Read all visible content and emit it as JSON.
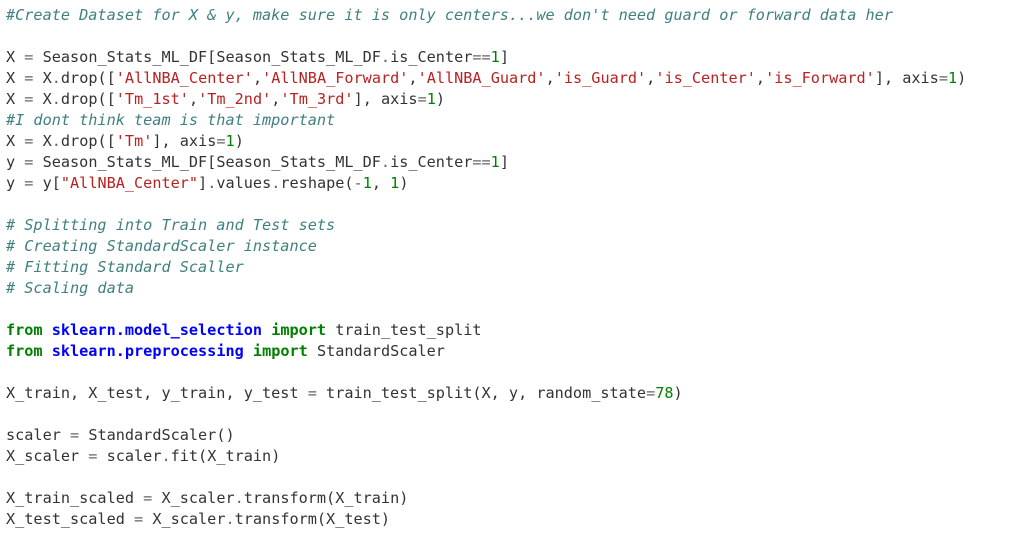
{
  "code_cell": {
    "lines": [
      [
        [
          "comment",
          "#Create Dataset for X & y, make sure it is only centers...we don't need guard or forward data her"
        ]
      ],
      [],
      [
        [
          "text",
          "X "
        ],
        [
          "op",
          "="
        ],
        [
          "text",
          " Season_Stats_ML_DF[Season_Stats_ML_DF"
        ],
        [
          "op",
          "."
        ],
        [
          "text",
          "is_Center"
        ],
        [
          "op",
          "=="
        ],
        [
          "number",
          "1"
        ],
        [
          "text",
          "]"
        ]
      ],
      [
        [
          "text",
          "X "
        ],
        [
          "op",
          "="
        ],
        [
          "text",
          " X"
        ],
        [
          "op",
          "."
        ],
        [
          "text",
          "drop(["
        ],
        [
          "string",
          "'AllNBA_Center'"
        ],
        [
          "text",
          ","
        ],
        [
          "string",
          "'AllNBA_Forward'"
        ],
        [
          "text",
          ","
        ],
        [
          "string",
          "'AllNBA_Guard'"
        ],
        [
          "text",
          ","
        ],
        [
          "string",
          "'is_Guard'"
        ],
        [
          "text",
          ","
        ],
        [
          "string",
          "'is_Center'"
        ],
        [
          "text",
          ","
        ],
        [
          "string",
          "'is_Forward'"
        ],
        [
          "text",
          "], axis"
        ],
        [
          "op",
          "="
        ],
        [
          "number",
          "1"
        ],
        [
          "text",
          ")"
        ]
      ],
      [
        [
          "text",
          "X "
        ],
        [
          "op",
          "="
        ],
        [
          "text",
          " X"
        ],
        [
          "op",
          "."
        ],
        [
          "text",
          "drop(["
        ],
        [
          "string",
          "'Tm_1st'"
        ],
        [
          "text",
          ","
        ],
        [
          "string",
          "'Tm_2nd'"
        ],
        [
          "text",
          ","
        ],
        [
          "string",
          "'Tm_3rd'"
        ],
        [
          "text",
          "], axis"
        ],
        [
          "op",
          "="
        ],
        [
          "number",
          "1"
        ],
        [
          "text",
          ")"
        ]
      ],
      [
        [
          "comment",
          "#I dont think team is that important"
        ]
      ],
      [
        [
          "text",
          "X "
        ],
        [
          "op",
          "="
        ],
        [
          "text",
          " X"
        ],
        [
          "op",
          "."
        ],
        [
          "text",
          "drop(["
        ],
        [
          "string",
          "'Tm'"
        ],
        [
          "text",
          "], axis"
        ],
        [
          "op",
          "="
        ],
        [
          "number",
          "1"
        ],
        [
          "text",
          ")"
        ]
      ],
      [
        [
          "text",
          "y "
        ],
        [
          "op",
          "="
        ],
        [
          "text",
          " Season_Stats_ML_DF[Season_Stats_ML_DF"
        ],
        [
          "op",
          "."
        ],
        [
          "text",
          "is_Center"
        ],
        [
          "op",
          "=="
        ],
        [
          "number",
          "1"
        ],
        [
          "text",
          "]"
        ]
      ],
      [
        [
          "text",
          "y "
        ],
        [
          "op",
          "="
        ],
        [
          "text",
          " y["
        ],
        [
          "string",
          "\"AllNBA_Center\""
        ],
        [
          "text",
          "]"
        ],
        [
          "op",
          "."
        ],
        [
          "text",
          "values"
        ],
        [
          "op",
          "."
        ],
        [
          "text",
          "reshape("
        ],
        [
          "op",
          "-"
        ],
        [
          "number",
          "1"
        ],
        [
          "text",
          ", "
        ],
        [
          "number",
          "1"
        ],
        [
          "text",
          ")"
        ]
      ],
      [],
      [
        [
          "comment",
          "# Splitting into Train and Test sets"
        ]
      ],
      [
        [
          "comment",
          "# Creating StandardScaler instance"
        ]
      ],
      [
        [
          "comment",
          "# Fitting Standard Scaller"
        ]
      ],
      [
        [
          "comment",
          "# Scaling data"
        ]
      ],
      [],
      [
        [
          "keyword",
          "from"
        ],
        [
          "text",
          " "
        ],
        [
          "module",
          "sklearn.model_selection"
        ],
        [
          "text",
          " "
        ],
        [
          "keyword",
          "import"
        ],
        [
          "text",
          " train_test_split"
        ]
      ],
      [
        [
          "keyword",
          "from"
        ],
        [
          "text",
          " "
        ],
        [
          "module",
          "sklearn.preprocessing"
        ],
        [
          "text",
          " "
        ],
        [
          "keyword",
          "import"
        ],
        [
          "text",
          " StandardScaler"
        ]
      ],
      [],
      [
        [
          "text",
          "X_train, X_test, y_train, y_test "
        ],
        [
          "op",
          "="
        ],
        [
          "text",
          " train_test_split(X, y, random_state"
        ],
        [
          "op",
          "="
        ],
        [
          "number",
          "78"
        ],
        [
          "text",
          ")"
        ]
      ],
      [],
      [
        [
          "text",
          "scaler "
        ],
        [
          "op",
          "="
        ],
        [
          "text",
          " StandardScaler()"
        ]
      ],
      [
        [
          "text",
          "X_scaler "
        ],
        [
          "op",
          "="
        ],
        [
          "text",
          " scaler"
        ],
        [
          "op",
          "."
        ],
        [
          "text",
          "fit(X_train)"
        ]
      ],
      [],
      [
        [
          "text",
          "X_train_scaled "
        ],
        [
          "op",
          "="
        ],
        [
          "text",
          " X_scaler"
        ],
        [
          "op",
          "."
        ],
        [
          "text",
          "transform(X_train)"
        ]
      ],
      [
        [
          "text",
          "X_test_scaled "
        ],
        [
          "op",
          "="
        ],
        [
          "text",
          " X_scaler"
        ],
        [
          "op",
          "."
        ],
        [
          "text",
          "transform(X_test)"
        ]
      ]
    ]
  }
}
